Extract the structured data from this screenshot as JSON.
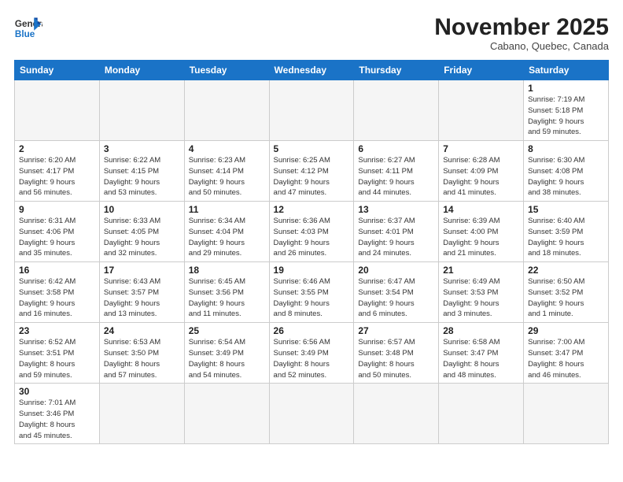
{
  "header": {
    "logo_general": "General",
    "logo_blue": "Blue",
    "month_title": "November 2025",
    "location": "Cabano, Quebec, Canada"
  },
  "days_of_week": [
    "Sunday",
    "Monday",
    "Tuesday",
    "Wednesday",
    "Thursday",
    "Friday",
    "Saturday"
  ],
  "weeks": [
    [
      {
        "day": "",
        "info": ""
      },
      {
        "day": "",
        "info": ""
      },
      {
        "day": "",
        "info": ""
      },
      {
        "day": "",
        "info": ""
      },
      {
        "day": "",
        "info": ""
      },
      {
        "day": "",
        "info": ""
      },
      {
        "day": "1",
        "info": "Sunrise: 7:19 AM\nSunset: 5:18 PM\nDaylight: 9 hours\nand 59 minutes."
      }
    ],
    [
      {
        "day": "2",
        "info": "Sunrise: 6:20 AM\nSunset: 4:17 PM\nDaylight: 9 hours\nand 56 minutes."
      },
      {
        "day": "3",
        "info": "Sunrise: 6:22 AM\nSunset: 4:15 PM\nDaylight: 9 hours\nand 53 minutes."
      },
      {
        "day": "4",
        "info": "Sunrise: 6:23 AM\nSunset: 4:14 PM\nDaylight: 9 hours\nand 50 minutes."
      },
      {
        "day": "5",
        "info": "Sunrise: 6:25 AM\nSunset: 4:12 PM\nDaylight: 9 hours\nand 47 minutes."
      },
      {
        "day": "6",
        "info": "Sunrise: 6:27 AM\nSunset: 4:11 PM\nDaylight: 9 hours\nand 44 minutes."
      },
      {
        "day": "7",
        "info": "Sunrise: 6:28 AM\nSunset: 4:09 PM\nDaylight: 9 hours\nand 41 minutes."
      },
      {
        "day": "8",
        "info": "Sunrise: 6:30 AM\nSunset: 4:08 PM\nDaylight: 9 hours\nand 38 minutes."
      }
    ],
    [
      {
        "day": "9",
        "info": "Sunrise: 6:31 AM\nSunset: 4:06 PM\nDaylight: 9 hours\nand 35 minutes."
      },
      {
        "day": "10",
        "info": "Sunrise: 6:33 AM\nSunset: 4:05 PM\nDaylight: 9 hours\nand 32 minutes."
      },
      {
        "day": "11",
        "info": "Sunrise: 6:34 AM\nSunset: 4:04 PM\nDaylight: 9 hours\nand 29 minutes."
      },
      {
        "day": "12",
        "info": "Sunrise: 6:36 AM\nSunset: 4:03 PM\nDaylight: 9 hours\nand 26 minutes."
      },
      {
        "day": "13",
        "info": "Sunrise: 6:37 AM\nSunset: 4:01 PM\nDaylight: 9 hours\nand 24 minutes."
      },
      {
        "day": "14",
        "info": "Sunrise: 6:39 AM\nSunset: 4:00 PM\nDaylight: 9 hours\nand 21 minutes."
      },
      {
        "day": "15",
        "info": "Sunrise: 6:40 AM\nSunset: 3:59 PM\nDaylight: 9 hours\nand 18 minutes."
      }
    ],
    [
      {
        "day": "16",
        "info": "Sunrise: 6:42 AM\nSunset: 3:58 PM\nDaylight: 9 hours\nand 16 minutes."
      },
      {
        "day": "17",
        "info": "Sunrise: 6:43 AM\nSunset: 3:57 PM\nDaylight: 9 hours\nand 13 minutes."
      },
      {
        "day": "18",
        "info": "Sunrise: 6:45 AM\nSunset: 3:56 PM\nDaylight: 9 hours\nand 11 minutes."
      },
      {
        "day": "19",
        "info": "Sunrise: 6:46 AM\nSunset: 3:55 PM\nDaylight: 9 hours\nand 8 minutes."
      },
      {
        "day": "20",
        "info": "Sunrise: 6:47 AM\nSunset: 3:54 PM\nDaylight: 9 hours\nand 6 minutes."
      },
      {
        "day": "21",
        "info": "Sunrise: 6:49 AM\nSunset: 3:53 PM\nDaylight: 9 hours\nand 3 minutes."
      },
      {
        "day": "22",
        "info": "Sunrise: 6:50 AM\nSunset: 3:52 PM\nDaylight: 9 hours\nand 1 minute."
      }
    ],
    [
      {
        "day": "23",
        "info": "Sunrise: 6:52 AM\nSunset: 3:51 PM\nDaylight: 8 hours\nand 59 minutes."
      },
      {
        "day": "24",
        "info": "Sunrise: 6:53 AM\nSunset: 3:50 PM\nDaylight: 8 hours\nand 57 minutes."
      },
      {
        "day": "25",
        "info": "Sunrise: 6:54 AM\nSunset: 3:49 PM\nDaylight: 8 hours\nand 54 minutes."
      },
      {
        "day": "26",
        "info": "Sunrise: 6:56 AM\nSunset: 3:49 PM\nDaylight: 8 hours\nand 52 minutes."
      },
      {
        "day": "27",
        "info": "Sunrise: 6:57 AM\nSunset: 3:48 PM\nDaylight: 8 hours\nand 50 minutes."
      },
      {
        "day": "28",
        "info": "Sunrise: 6:58 AM\nSunset: 3:47 PM\nDaylight: 8 hours\nand 48 minutes."
      },
      {
        "day": "29",
        "info": "Sunrise: 7:00 AM\nSunset: 3:47 PM\nDaylight: 8 hours\nand 46 minutes."
      }
    ],
    [
      {
        "day": "30",
        "info": "Sunrise: 7:01 AM\nSunset: 3:46 PM\nDaylight: 8 hours\nand 45 minutes."
      },
      {
        "day": "",
        "info": ""
      },
      {
        "day": "",
        "info": ""
      },
      {
        "day": "",
        "info": ""
      },
      {
        "day": "",
        "info": ""
      },
      {
        "day": "",
        "info": ""
      },
      {
        "day": "",
        "info": ""
      }
    ]
  ]
}
